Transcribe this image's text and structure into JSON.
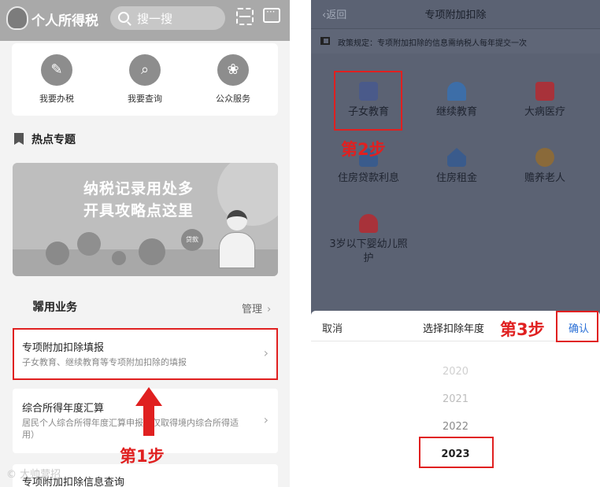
{
  "left": {
    "app_title": "个人所得税",
    "search_placeholder": "搜一搜",
    "quick_actions": [
      {
        "label": "我要办税",
        "icon": "pencil-icon"
      },
      {
        "label": "我要查询",
        "icon": "search-icon"
      },
      {
        "label": "公众服务",
        "icon": "service-icon"
      }
    ],
    "hot_title": "热点专题",
    "banner_lines": [
      "纳税记录用处多",
      "开具攻略点这里"
    ],
    "banner_badge": "贷款",
    "common_title": "常用业务",
    "manage_label": "管理",
    "cards": [
      {
        "title": "专项附加扣除填报",
        "desc": "子女教育、继续教育等专项附加扣除的填报"
      },
      {
        "title": "综合所得年度汇算",
        "desc": "居民个人综合所得年度汇算申报（仅取得境内综合所得适用）"
      },
      {
        "title": "专项附加扣除信息查询",
        "desc": ""
      }
    ],
    "step1": "第1步",
    "watermark": "© 大帅营招"
  },
  "right": {
    "back_label": "返回",
    "nav_title": "专项附加扣除",
    "policy_text": "政策规定：专项附加扣除的信息需纳税人每年提交一次",
    "categories": [
      {
        "label": "子女教育",
        "icon": "books-icon",
        "color": "#4a5a8a"
      },
      {
        "label": "继续教育",
        "icon": "graduation-cap-icon",
        "color": "#3d6ea8"
      },
      {
        "label": "大病医疗",
        "icon": "medical-kit-icon",
        "color": "#a8323a"
      },
      {
        "label": "住房贷款利息",
        "icon": "house-loan-icon",
        "color": "#3a5b8c"
      },
      {
        "label": "住房租金",
        "icon": "house-rent-icon",
        "color": "#3a5b8c"
      },
      {
        "label": "赡养老人",
        "icon": "elder-icon",
        "color": "#8a6a3a"
      },
      {
        "label": "3岁以下婴幼儿照护",
        "icon": "baby-icon",
        "color": "#a8323a"
      }
    ],
    "step2": "第2步",
    "sheet": {
      "cancel": "取消",
      "title": "选择扣除年度",
      "confirm": "确认",
      "years": [
        "2020",
        "2021",
        "2022",
        "2023"
      ],
      "selected": "2023"
    },
    "step3": "第3步"
  },
  "highlight_color": "#e02020"
}
